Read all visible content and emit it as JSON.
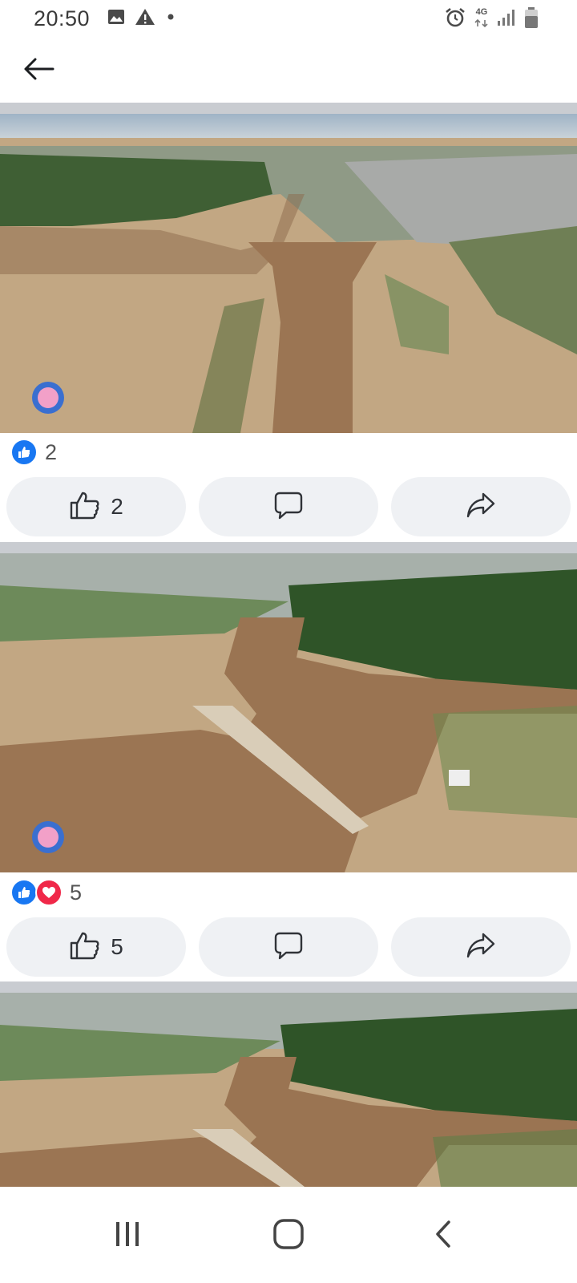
{
  "status_bar": {
    "time": "20:50",
    "left_icons": [
      "image-icon",
      "warning-icon",
      "dot-icon"
    ],
    "right_icons": [
      "alarm-icon",
      "4g-icon",
      "signal-icon",
      "battery-icon"
    ],
    "network_label": "4G"
  },
  "top_bar": {
    "back_icon": "arrow-left-icon"
  },
  "posts": [
    {
      "photo_desc_icon": "photo",
      "reactions": [
        "like"
      ],
      "reactions_count": "2",
      "like_count": "2"
    },
    {
      "photo_desc_icon": "photo",
      "reactions": [
        "like",
        "love"
      ],
      "reactions_count": "5",
      "like_count": "5"
    },
    {
      "photo_desc_icon": "photo"
    }
  ],
  "nav_bar": {
    "items": [
      "recent-apps-icon",
      "home-icon",
      "back-icon"
    ]
  },
  "colors": {
    "facebook_blue": "#1877f2",
    "love_red": "#f02849",
    "button_bg": "#eff1f4",
    "separator": "#c9ccd1"
  }
}
